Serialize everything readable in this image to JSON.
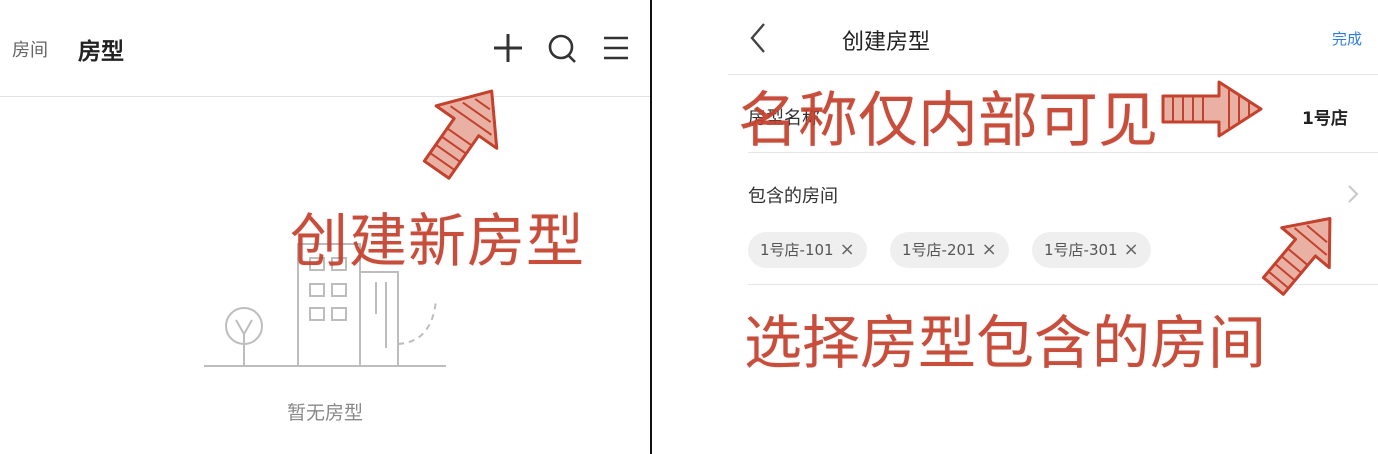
{
  "left": {
    "tabs": {
      "rooms_label": "房间",
      "room_types_label": "房型"
    },
    "header_icons": [
      "plus-icon",
      "search-icon",
      "menu-icon"
    ],
    "empty_state_text": "暂无房型",
    "annotation_text": "创建新房型"
  },
  "right": {
    "header": {
      "back_icon": "chevron-left-icon",
      "title": "创建房型",
      "done_label": "完成"
    },
    "name_row": {
      "label": "房型名称",
      "value": "1号店"
    },
    "rooms_row": {
      "label": "包含的房间",
      "chips": [
        "1号店-101",
        "1号店-201",
        "1号店-301"
      ],
      "chip_remove_glyph": "×"
    },
    "annotations": {
      "name_note": "名称仅内部可见",
      "rooms_note": "选择房型包含的房间"
    }
  },
  "colors": {
    "accent_link": "#2f7de1",
    "annotation_red": "#c4412d",
    "chip_bg": "#efefef",
    "divider": "#111111"
  }
}
